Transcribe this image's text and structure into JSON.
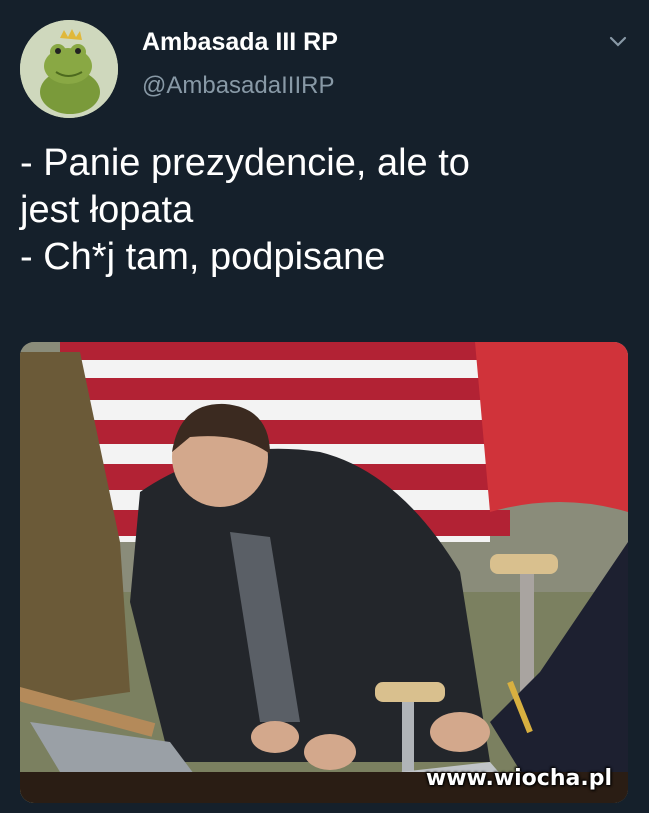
{
  "tweet": {
    "display_name": "Ambasada III RP",
    "handle": "@AmbasadaIIIRP",
    "avatar_icon": "frog-prince-icon",
    "menu_icon": "chevron-down-icon",
    "text_lines": [
      "- Panie prezydencie, ale to",
      "jest łopata",
      "- Ch*j tam, podpisane"
    ]
  },
  "media": {
    "watermark": "www.wiocha.pl"
  },
  "colors": {
    "background": "#15202b",
    "name": "#ffffff",
    "handle": "#8899a6",
    "flag_red": "#b22234",
    "flag_white": "#f3f3f3"
  }
}
